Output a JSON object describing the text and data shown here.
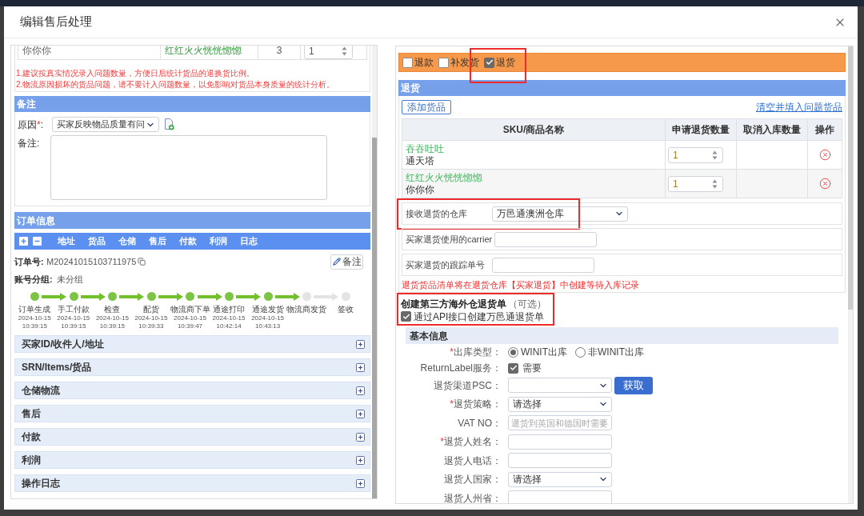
{
  "dialog": {
    "title": "编辑售后处理"
  },
  "left_panel": {
    "issue_table": {
      "rows": [
        {
          "column_1": "你你你",
          "column_2": "红红火火恍恍惚惚",
          "column_3": "3",
          "quantity": "1"
        }
      ]
    },
    "tips": [
      "1.建议按真实情况录入问题数量，方便日后统计货品的退换货比例。",
      "2.物流原因损坏的货品问题，请不要计入问题数量，以免影响对货品本身质量的统计分析。"
    ],
    "remark": {
      "title": "备注",
      "reason": {
        "label": "原因",
        "required_mark": "*",
        "label_end": ":",
        "value": "买家反映物品质量有问"
      },
      "note": {
        "label": "备注:"
      }
    },
    "order_info": {
      "title": "订单信息",
      "toolbar_tabs": [
        "地址",
        "货品",
        "仓储",
        "售后",
        "付款",
        "利润",
        "日志"
      ],
      "order_no": {
        "label": "订单号:",
        "value": "M20241015103711975"
      },
      "remark_button": "备注",
      "account_group": {
        "label": "账号分组:",
        "value": "未分组"
      },
      "timeline": [
        {
          "label": "订单生成",
          "date": "2024-10-15",
          "time": "10:39:15",
          "done": true
        },
        {
          "label": "手工付款",
          "date": "2024-10-15",
          "time": "10:39:15",
          "done": true
        },
        {
          "label": "检查",
          "date": "2024-10-15",
          "time": "10:39:15",
          "done": true
        },
        {
          "label": "配货",
          "date": "2024-10-15",
          "time": "10:39:33",
          "done": true
        },
        {
          "label": "物流商下单",
          "date": "2024-10-15",
          "time": "10:39:47",
          "done": true
        },
        {
          "label": "通途打印",
          "date": "2024-10-15",
          "time": "10:42:14",
          "done": true
        },
        {
          "label": "通途发货",
          "date": "2024-10-15",
          "time": "10:43:13",
          "done": true
        },
        {
          "label": "物流商发货",
          "done": false
        },
        {
          "label": "签收",
          "done": false
        }
      ]
    },
    "sections": [
      {
        "title": "买家ID/收件人/地址",
        "expanded": false
      },
      {
        "title": "SRN/Items/货品",
        "expanded": false
      },
      {
        "title": "仓储物流",
        "expanded": false
      },
      {
        "title": "售后",
        "expanded": false
      },
      {
        "title": "付款",
        "expanded": false
      },
      {
        "title": "利润",
        "expanded": false
      },
      {
        "title": "操作日志",
        "expanded": false
      }
    ]
  },
  "right_panel": {
    "handling_types": [
      {
        "label": "退款",
        "checked": false
      },
      {
        "label": "补发货",
        "checked": false
      },
      {
        "label": "退货",
        "checked": true,
        "highlighted": true
      }
    ],
    "return_section": {
      "title": "退货",
      "add_button": "添加货品",
      "clear_link": "清空并填入问题货品",
      "table": {
        "columns": [
          "SKU/商品名称",
          "申请退货数量",
          "取消入库数量",
          "操作"
        ],
        "rows": [
          {
            "sku": "吞吞吐吐",
            "name": "通天塔",
            "quantity": "1"
          },
          {
            "sku": "红红火火恍恍惚惚",
            "name": "你你你",
            "quantity": "1"
          }
        ]
      },
      "fields": [
        {
          "kind": "select",
          "label": "接收退货的仓库",
          "value": "万邑通澳洲仓库",
          "highlighted": true
        },
        {
          "kind": "input",
          "label": "买家退货使用的carrier"
        },
        {
          "kind": "input",
          "label": "买家退货的跟踪单号"
        }
      ],
      "notice": "退货货品清单将在退货仓库【买家退货】中创建等待入库记录"
    },
    "third_party": {
      "title": "创建第三方海外仓退货单",
      "optional": "（可选）",
      "highlighted": true,
      "api_option": {
        "label": "通过API接口创建万邑通退货单",
        "checked": true
      },
      "basic_info": {
        "title": "基本信息",
        "rows": [
          {
            "kind": "radio",
            "required_mark": "*",
            "label": "出库类型：",
            "options": [
              {
                "label": "WINIT出库",
                "selected": true
              },
              {
                "label": "非WINIT出库",
                "selected": false
              }
            ]
          },
          {
            "kind": "checkbox",
            "label": "ReturnLabel服务：",
            "option": "需要",
            "checked": true
          },
          {
            "kind": "select",
            "label": "退货渠道PSC：",
            "button": "获取"
          },
          {
            "kind": "select",
            "required_mark": "*",
            "label": "退货策略：",
            "value": "请选择"
          },
          {
            "kind": "input",
            "label": "VAT NO：",
            "placeholder": "退货到英国和德国时需要"
          },
          {
            "kind": "input",
            "required_mark": "*",
            "label": "退货人姓名："
          },
          {
            "kind": "input",
            "label": "退货人电话："
          },
          {
            "kind": "select",
            "label": "退货人国家：",
            "value": "请选择"
          },
          {
            "kind": "input",
            "label": "退货人州省："
          }
        ]
      }
    }
  }
}
